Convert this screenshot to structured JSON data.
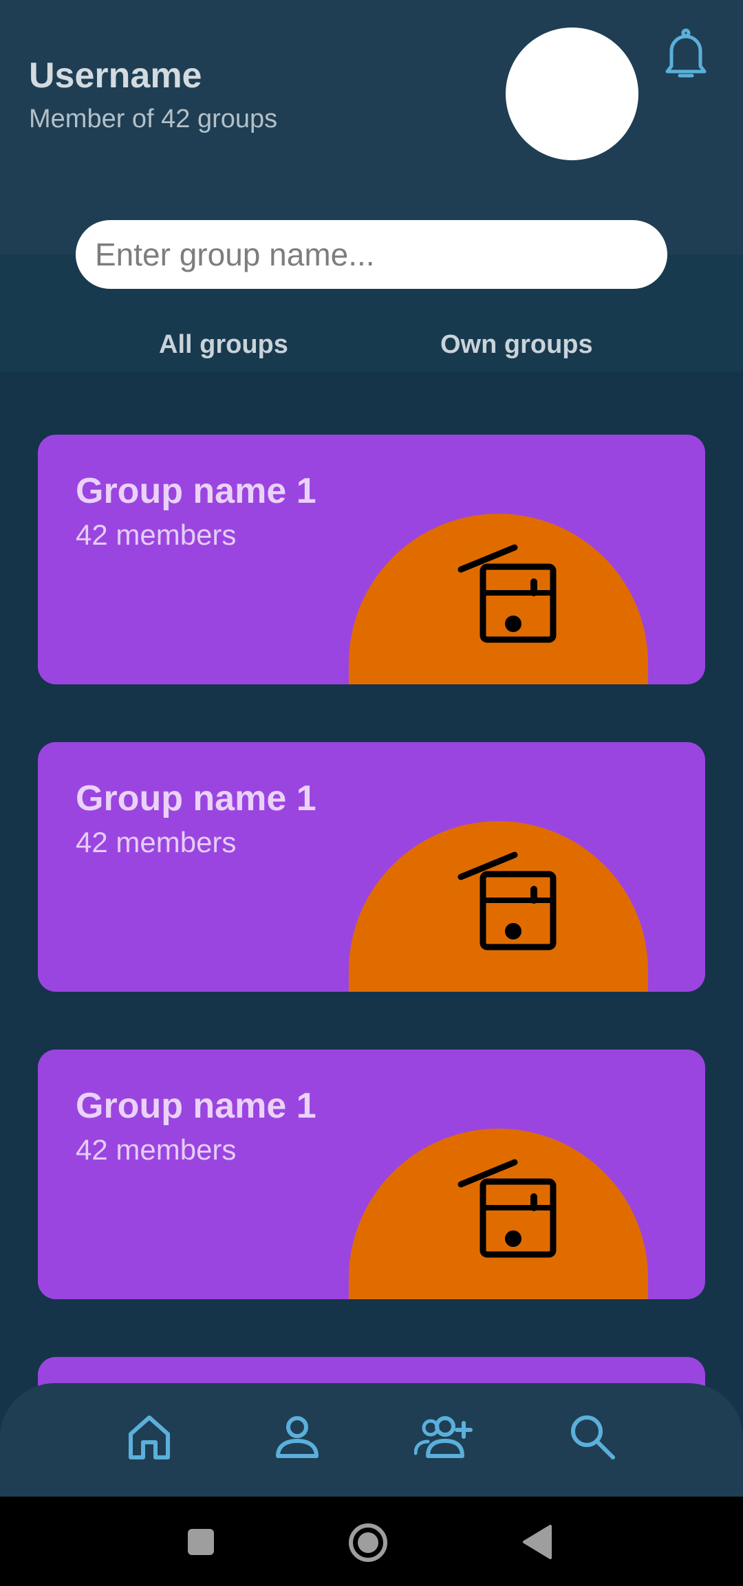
{
  "header": {
    "username": "Username",
    "membership": "Member of 42 groups"
  },
  "search": {
    "placeholder": "Enter group name..."
  },
  "tabs": [
    {
      "label": "All groups"
    },
    {
      "label": "Own groups"
    }
  ],
  "groups": [
    {
      "name": "Group name 1",
      "members": "42 members",
      "icon": "radio-icon"
    },
    {
      "name": "Group name 1",
      "members": "42 members",
      "icon": "radio-icon"
    },
    {
      "name": "Group name 1",
      "members": "42 members",
      "icon": "radio-icon"
    }
  ],
  "bottom_nav": [
    {
      "icon": "home-icon"
    },
    {
      "icon": "profile-icon"
    },
    {
      "icon": "add-group-icon"
    },
    {
      "icon": "search-icon"
    }
  ],
  "system_nav": [
    {
      "icon": "recents-square-icon"
    },
    {
      "icon": "home-circle-icon"
    },
    {
      "icon": "back-triangle-icon"
    }
  ],
  "colors": {
    "header_bg": "#1f3e53",
    "page_bg": "#15344a",
    "card_bg": "#9b45e0",
    "card_accent": "#e06c00",
    "icon_accent": "#5bb0db"
  }
}
